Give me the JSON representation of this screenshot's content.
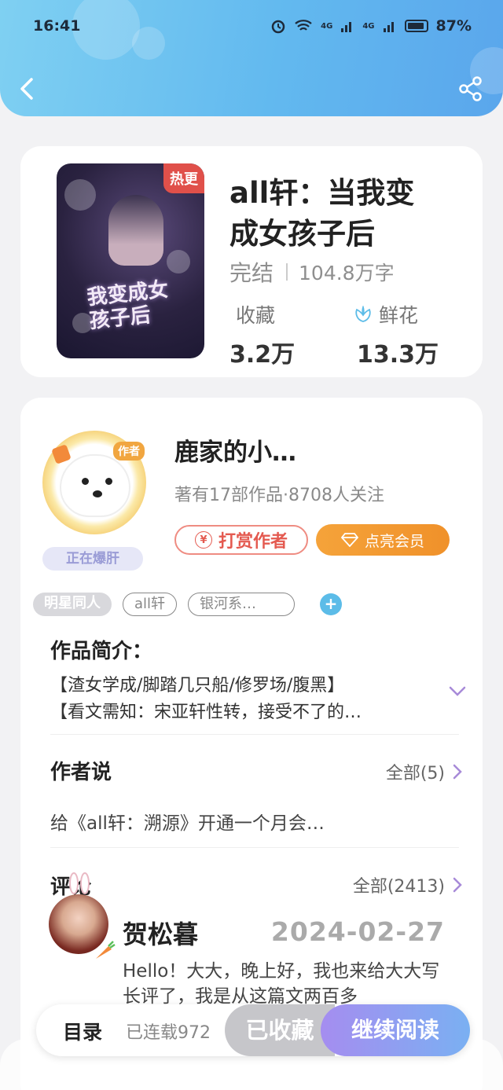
{
  "status_bar": {
    "time": "16:41",
    "signal_1": "4G",
    "signal_2": "4G",
    "battery": "87%"
  },
  "book": {
    "badge": "热更",
    "cover_art_text": "我变成女孩子后",
    "title_line1": "all轩：当我变",
    "title_line2": "成女孩子后",
    "status": "完结",
    "word_count": "104.8万字",
    "favorites_label": "收藏",
    "favorites_value": "3.2万",
    "flowers_label": "鲜花",
    "flowers_value": "13.3万"
  },
  "author": {
    "tag": "作者",
    "name": "鹿家的小…",
    "info": "著有17部作品·8708人关注",
    "status_badge": "正在爆肝",
    "tip_button": "打赏作者",
    "vip_button": "点亮会员"
  },
  "tags": [
    "明星同人",
    "all轩",
    "银河系…"
  ],
  "intro": {
    "title": "作品简介：",
    "lines": [
      "【渣女学成/脚踏几只船/修罗场/腹黑】",
      "【看文需知：宋亚轩性转，接受不了的…"
    ]
  },
  "author_says": {
    "title": "作者说",
    "more": "全部(5)",
    "text": "给《all轩：溯源》开通一个月会…"
  },
  "comments": {
    "title": "评论",
    "more": "全部(2413)",
    "items": [
      {
        "user": "贺松暮",
        "date": "2024-02-27",
        "text": "Hello！大大，晚上好，我也来给大大写长评了，我是从这篇文两百多"
      }
    ]
  },
  "bottom_bar": {
    "toc": "目录",
    "serial": "已连载972",
    "collected": "已收藏",
    "continue": "继续阅读"
  },
  "colors": {
    "header_start": "#7fd0f2",
    "header_end": "#5aa6ec",
    "tip_red": "#e45a50",
    "vip_orange": "#f0912a",
    "read_gradient_start": "#a58df0",
    "read_gradient_end": "#7ab0f2"
  }
}
